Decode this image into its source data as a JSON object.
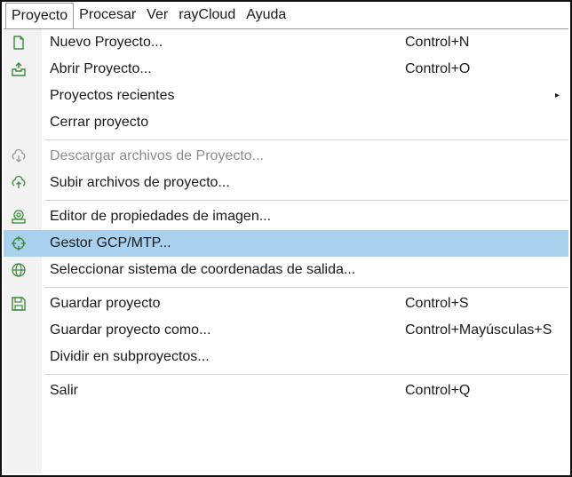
{
  "menubar": {
    "items": [
      "Proyecto",
      "Procesar",
      "Ver",
      "rayCloud",
      "Ayuda"
    ]
  },
  "menu": {
    "items": [
      {
        "label": "Nuevo Proyecto...",
        "shortcut": "Control+N",
        "icon": "new-project-icon"
      },
      {
        "label": "Abrir Proyecto...",
        "shortcut": "Control+O",
        "icon": "open-project-icon"
      },
      {
        "label": "Proyectos recientes",
        "shortcut": "",
        "icon": "",
        "submenu": true
      },
      {
        "label": "Cerrar proyecto",
        "shortcut": "",
        "icon": ""
      },
      {
        "label": "Descargar archivos de Proyecto...",
        "shortcut": "",
        "icon": "cloud-download-icon",
        "disabled": true
      },
      {
        "label": "Subir archivos de proyecto...",
        "shortcut": "",
        "icon": "cloud-upload-icon"
      },
      {
        "label": "Editor de propiedades de imagen...",
        "shortcut": "",
        "icon": "camera-icon"
      },
      {
        "label": "Gestor GCP/MTP...",
        "shortcut": "",
        "icon": "crosshair-icon",
        "highlighted": true
      },
      {
        "label": "Seleccionar sistema de coordenadas de salida...",
        "shortcut": "",
        "icon": "globe-icon"
      },
      {
        "label": "Guardar proyecto",
        "shortcut": "Control+S",
        "icon": "save-icon"
      },
      {
        "label": "Guardar proyecto como...",
        "shortcut": "Control+Mayúsculas+S",
        "icon": ""
      },
      {
        "label": "Dividir en subproyectos...",
        "shortcut": "",
        "icon": ""
      },
      {
        "label": "Salir",
        "shortcut": "Control+Q",
        "icon": ""
      }
    ],
    "submenu_arrow": "▸"
  },
  "colors": {
    "highlight": "#a9d1ee",
    "icon_green": "#3c8a3c",
    "disabled_text": "#8c8c8c"
  }
}
